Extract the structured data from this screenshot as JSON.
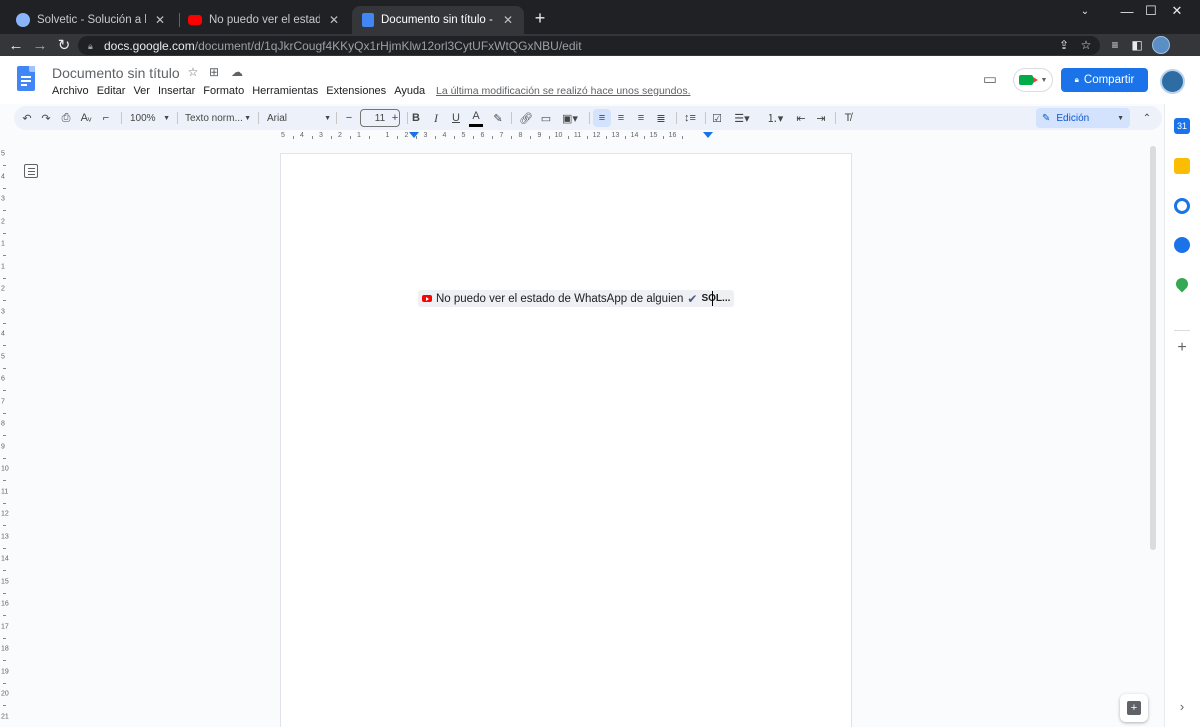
{
  "browser": {
    "tabs": [
      {
        "title": "Solvetic - Solución a los problem",
        "favicon": "solvetic-icon"
      },
      {
        "title": "No puedo ver el estado de What",
        "favicon": "youtube-icon"
      },
      {
        "title": "Documento sin título - Documen",
        "favicon": "docs-icon",
        "active": true
      }
    ],
    "new_tab_label": "+",
    "window_controls": {
      "minimize": "—",
      "maximize": "☐",
      "close": "✕"
    },
    "url_host": "docs.google.com",
    "url_path": "/document/d/1qJkrCougf4KKyQx1rHjmKlw12orl3CytUFxWtQGxNBU/edit"
  },
  "docs": {
    "title": "Documento sin título",
    "menu": [
      "Archivo",
      "Editar",
      "Ver",
      "Insertar",
      "Formato",
      "Herramientas",
      "Extensiones",
      "Ayuda"
    ],
    "last_edit": "La última modificación se realizó hace unos segundos.",
    "share_label": "Compartir",
    "accent_color": "#1a73e8"
  },
  "toolbar": {
    "zoom": "100%",
    "style": "Texto norm...",
    "font": "Arial",
    "font_size": "11",
    "minus": "−",
    "plus": "+",
    "bold": "B",
    "italic": "I",
    "underline": "U",
    "color": "A",
    "mode": "Edición"
  },
  "ruler": {
    "labels": [
      "5",
      "4",
      "3",
      "2",
      "1",
      "1",
      "2",
      "3",
      "4",
      "5",
      "6",
      "7",
      "8",
      "9",
      "10",
      "11",
      "12",
      "13",
      "14",
      "15",
      "16"
    ]
  },
  "vruler": {
    "labels": [
      "5",
      "4",
      "3",
      "2",
      "1",
      "1",
      "2",
      "3",
      "4",
      "5",
      "6",
      "7",
      "8",
      "9",
      "10",
      "11",
      "12",
      "13",
      "14",
      "15",
      "16",
      "17",
      "18",
      "19",
      "20",
      "21"
    ]
  },
  "document": {
    "chip_text": "No puedo ver el estado de WhatsApp de alguien",
    "chip_check": "✔",
    "chip_suffix": "SOL..."
  },
  "side_panel": {
    "calendar_label": "31"
  }
}
